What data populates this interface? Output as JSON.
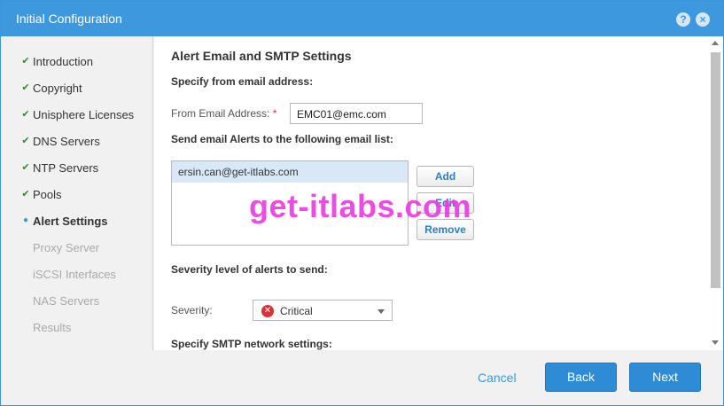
{
  "window": {
    "title": "Initial Configuration"
  },
  "titlebar_icons": {
    "help": "?",
    "close": "×",
    "help_icon": "help-icon",
    "close_icon": "close-icon"
  },
  "sidebar": {
    "steps": [
      {
        "label": "Introduction",
        "state": "done",
        "mark": "✔"
      },
      {
        "label": "Copyright",
        "state": "done",
        "mark": "✔"
      },
      {
        "label": "Unisphere Licenses",
        "state": "done",
        "mark": "✔"
      },
      {
        "label": "DNS Servers",
        "state": "done",
        "mark": "✔"
      },
      {
        "label": "NTP Servers",
        "state": "done",
        "mark": "✔"
      },
      {
        "label": "Pools",
        "state": "done",
        "mark": "✔"
      },
      {
        "label": "Alert Settings",
        "state": "current",
        "mark": "●"
      },
      {
        "label": "Proxy Server",
        "state": "future",
        "mark": ""
      },
      {
        "label": "iSCSI Interfaces",
        "state": "future",
        "mark": ""
      },
      {
        "label": "NAS Servers",
        "state": "future",
        "mark": ""
      },
      {
        "label": "Results",
        "state": "future",
        "mark": ""
      }
    ]
  },
  "main": {
    "heading": "Alert Email and SMTP Settings",
    "from_section": "Specify from email address:",
    "from_label": "From Email Address:",
    "required_mark": "*",
    "from_value": "EMC01@emc.com",
    "list_section": "Send email Alerts to the following email list:",
    "email_list": [
      "ersin.can@get-itlabs.com"
    ],
    "buttons": {
      "add": "Add",
      "edit": "Edit",
      "remove": "Remove"
    },
    "severity_section": "Severity level of alerts to send:",
    "severity_label": "Severity:",
    "severity_value": "Critical",
    "severity_icon": "critical-error-icon",
    "smtp_section": "Specify SMTP network settings:"
  },
  "footer": {
    "cancel": "Cancel",
    "back": "Back",
    "next": "Next"
  },
  "watermark": "get-itlabs.com",
  "colors": {
    "accent": "#3d98dd",
    "primary_button": "#2e8bd6",
    "check": "#2e8b2e",
    "critical": "#d9313a",
    "watermark": "#e83ee0"
  }
}
